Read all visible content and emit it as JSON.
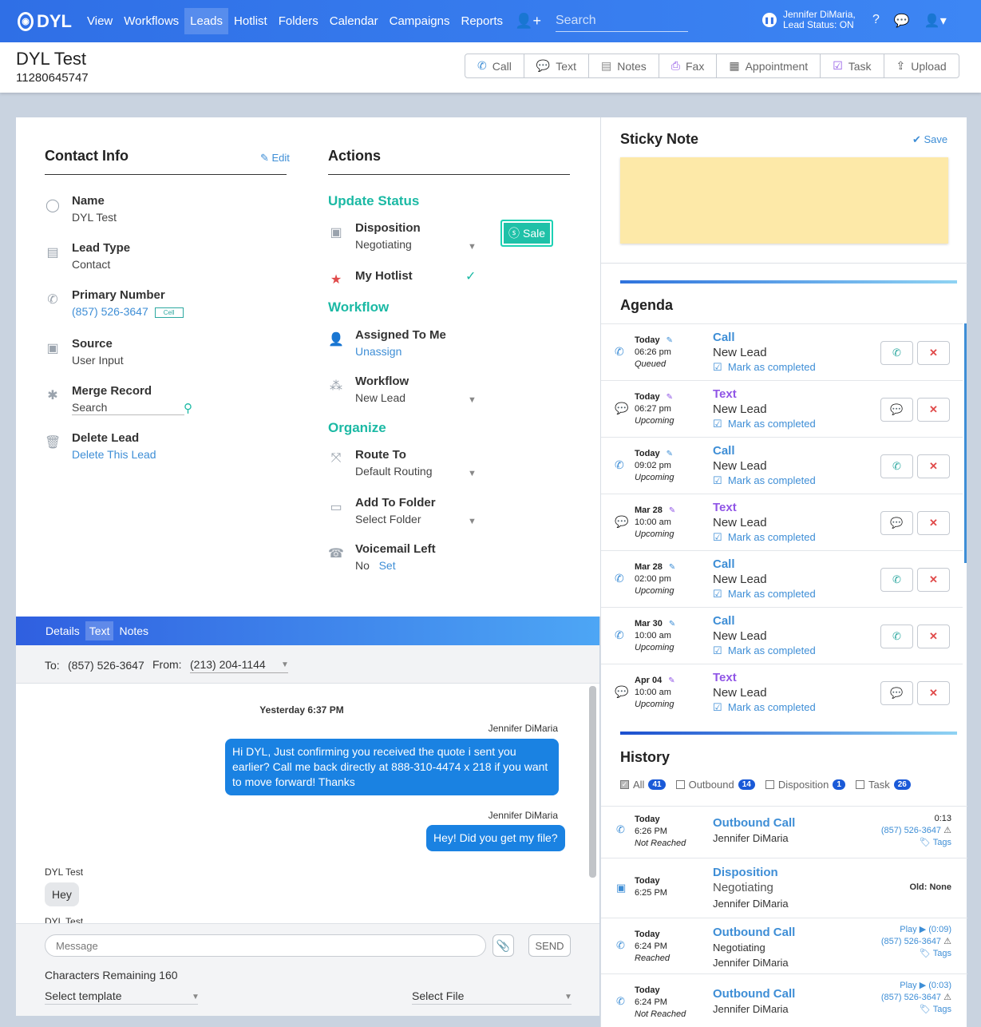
{
  "nav": {
    "logo": "DYL",
    "items": [
      {
        "label": "View",
        "active": false
      },
      {
        "label": "Workflows",
        "active": false
      },
      {
        "label": "Leads",
        "active": true
      },
      {
        "label": "Hotlist",
        "active": false
      },
      {
        "label": "Folders",
        "active": false
      },
      {
        "label": "Calendar",
        "active": false
      },
      {
        "label": "Campaigns",
        "active": false
      },
      {
        "label": "Reports",
        "active": false
      }
    ],
    "search_placeholder": "Search",
    "user_name": "Jennifer DiMaria,",
    "lead_status": "Lead Status: ON"
  },
  "header": {
    "title": "DYL Test",
    "number": "11280645747",
    "buttons": [
      "Call",
      "Text",
      "Notes",
      "Fax",
      "Appointment",
      "Task",
      "Upload"
    ]
  },
  "contact": {
    "heading": "Contact Info",
    "edit": "Edit",
    "name_label": "Name",
    "name_value": "DYL Test",
    "leadtype_label": "Lead Type",
    "leadtype_value": "Contact",
    "phone_label": "Primary Number",
    "phone_value": "(857) 526-3647",
    "phone_tag": "Cell",
    "source_label": "Source",
    "source_value": "User Input",
    "merge_label": "Merge Record",
    "merge_placeholder": "Search",
    "delete_label": "Delete Lead",
    "delete_link": "Delete This Lead"
  },
  "actions": {
    "heading": "Actions",
    "update_status": "Update Status",
    "disposition_label": "Disposition",
    "disposition_value": "Negotiating",
    "sale": "Sale",
    "hotlist_label": "My Hotlist",
    "workflow_heading": "Workflow",
    "assigned_label": "Assigned To Me",
    "assigned_link": "Unassign",
    "workflow_label": "Workflow",
    "workflow_value": "New Lead",
    "organize_heading": "Organize",
    "route_label": "Route To",
    "route_value": "Default Routing",
    "folder_label": "Add To Folder",
    "folder_value": "Select Folder",
    "voicemail_label": "Voicemail Left",
    "voicemail_value": "No",
    "voicemail_link": "Set"
  },
  "tabs": [
    {
      "label": "Details",
      "active": false
    },
    {
      "label": "Text",
      "active": true
    },
    {
      "label": "Notes",
      "active": false
    }
  ],
  "messaging": {
    "to_label": "To:",
    "to_value": "(857) 526-3647",
    "from_label": "From:",
    "from_value": "(213) 204-1144",
    "date_divider": "Yesterday 6:37 PM",
    "msg1_sender": "Jennifer DiMaria",
    "msg1_text": "Hi DYL, Just confirming you received the quote i sent you earlier? Call me back directly at 888-310-4474 x 218 if you want to move forward! Thanks",
    "msg2_sender": "Jennifer DiMaria",
    "msg2_text": "Hey! Did you get my file?",
    "msg3_sender": "DYL Test",
    "msg3_text": "Hey",
    "msg4_sender": "DYL Test",
    "input_placeholder": "Message",
    "send": "SEND",
    "chars_remaining": "Characters Remaining 160",
    "select_template": "Select template",
    "select_file": "Select File"
  },
  "sticky": {
    "heading": "Sticky Note",
    "save": "Save"
  },
  "agenda": {
    "heading": "Agenda",
    "mark": "Mark as completed",
    "items": [
      {
        "day": "Today",
        "time": "06:26 pm",
        "status": "Queued",
        "type": "Call",
        "name": "New Lead"
      },
      {
        "day": "Today",
        "time": "06:27 pm",
        "status": "Upcoming",
        "type": "Text",
        "name": "New Lead"
      },
      {
        "day": "Today",
        "time": "09:02 pm",
        "status": "Upcoming",
        "type": "Call",
        "name": "New Lead"
      },
      {
        "day": "Mar 28",
        "time": "10:00 am",
        "status": "Upcoming",
        "type": "Text",
        "name": "New Lead"
      },
      {
        "day": "Mar 28",
        "time": "02:00 pm",
        "status": "Upcoming",
        "type": "Call",
        "name": "New Lead"
      },
      {
        "day": "Mar 30",
        "time": "10:00 am",
        "status": "Upcoming",
        "type": "Call",
        "name": "New Lead"
      },
      {
        "day": "Apr 04",
        "time": "10:00 am",
        "status": "Upcoming",
        "type": "Text",
        "name": "New Lead"
      }
    ]
  },
  "history": {
    "heading": "History",
    "filters": [
      {
        "label": "All",
        "count": "41",
        "checked": true
      },
      {
        "label": "Outbound",
        "count": "14",
        "checked": false
      },
      {
        "label": "Disposition",
        "count": "1",
        "checked": false
      },
      {
        "label": "Task",
        "count": "26",
        "checked": false
      }
    ],
    "items": [
      {
        "day": "Today",
        "time": "6:26 PM",
        "status": "Not Reached",
        "type": "Outbound Call",
        "line1": "Jennifer DiMaria",
        "line2": "",
        "duration": "0:13",
        "play": "",
        "phone": "(857) 526-3647",
        "tags": "Tags"
      },
      {
        "day": "Today",
        "time": "6:25 PM",
        "status": "",
        "type": "Disposition",
        "line1": "Negotiating",
        "line2": "Jennifer DiMaria",
        "old": "Old: None"
      },
      {
        "day": "Today",
        "time": "6:24 PM",
        "status": "Reached",
        "type": "Outbound Call",
        "line1": "Negotiating",
        "line2": "Jennifer DiMaria",
        "duration": "",
        "play": "Play ▶ (0:09)",
        "phone": "(857) 526-3647",
        "tags": "Tags"
      },
      {
        "day": "Today",
        "time": "6:24 PM",
        "status": "Not Reached",
        "type": "Outbound Call",
        "line1": "Jennifer DiMaria",
        "line2": "",
        "duration": "",
        "play": "Play ▶ (0:03)",
        "phone": "(857) 526-3647",
        "tags": "Tags"
      }
    ]
  }
}
